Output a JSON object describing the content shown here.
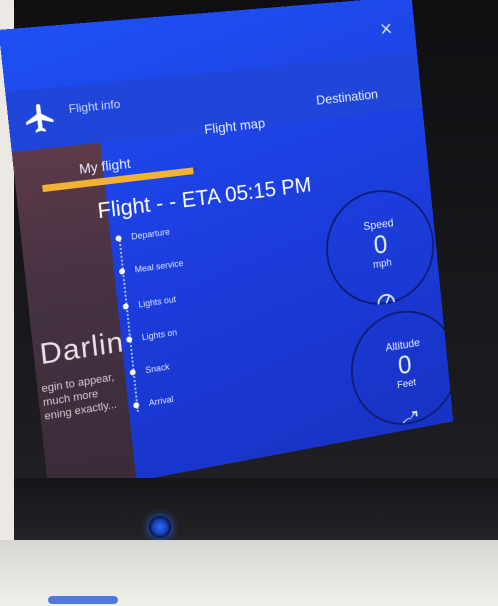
{
  "header": {
    "close_symbol": "×",
    "section_label": "Flight info",
    "plane_icon": "airplane-icon"
  },
  "tabs": [
    {
      "label": "My flight",
      "active": true
    },
    {
      "label": "Flight map",
      "active": false
    },
    {
      "label": "Destination",
      "active": false
    }
  ],
  "flight": {
    "title": "Flight - - ETA 05:15 PM"
  },
  "timeline": [
    "Departure",
    "Meal service",
    "Lights out",
    "Lights on",
    "Snack",
    "Arrival"
  ],
  "gauges": {
    "speed": {
      "label": "Speed",
      "value": "0",
      "unit": "mph",
      "icon": "speedometer-icon"
    },
    "altitude": {
      "label": "Altitude",
      "value": "0",
      "unit": "Feet",
      "icon": "climb-icon"
    }
  },
  "background_art": {
    "text": "Darlin",
    "subtext": "egin to appear,\nmuch more\nening exactly..."
  },
  "colors": {
    "screen_blue": "#1f50f4",
    "accent_yellow": "#f2b233",
    "gauge_ring": "#0f1d73",
    "home_button_glow": "#2b6cff"
  }
}
